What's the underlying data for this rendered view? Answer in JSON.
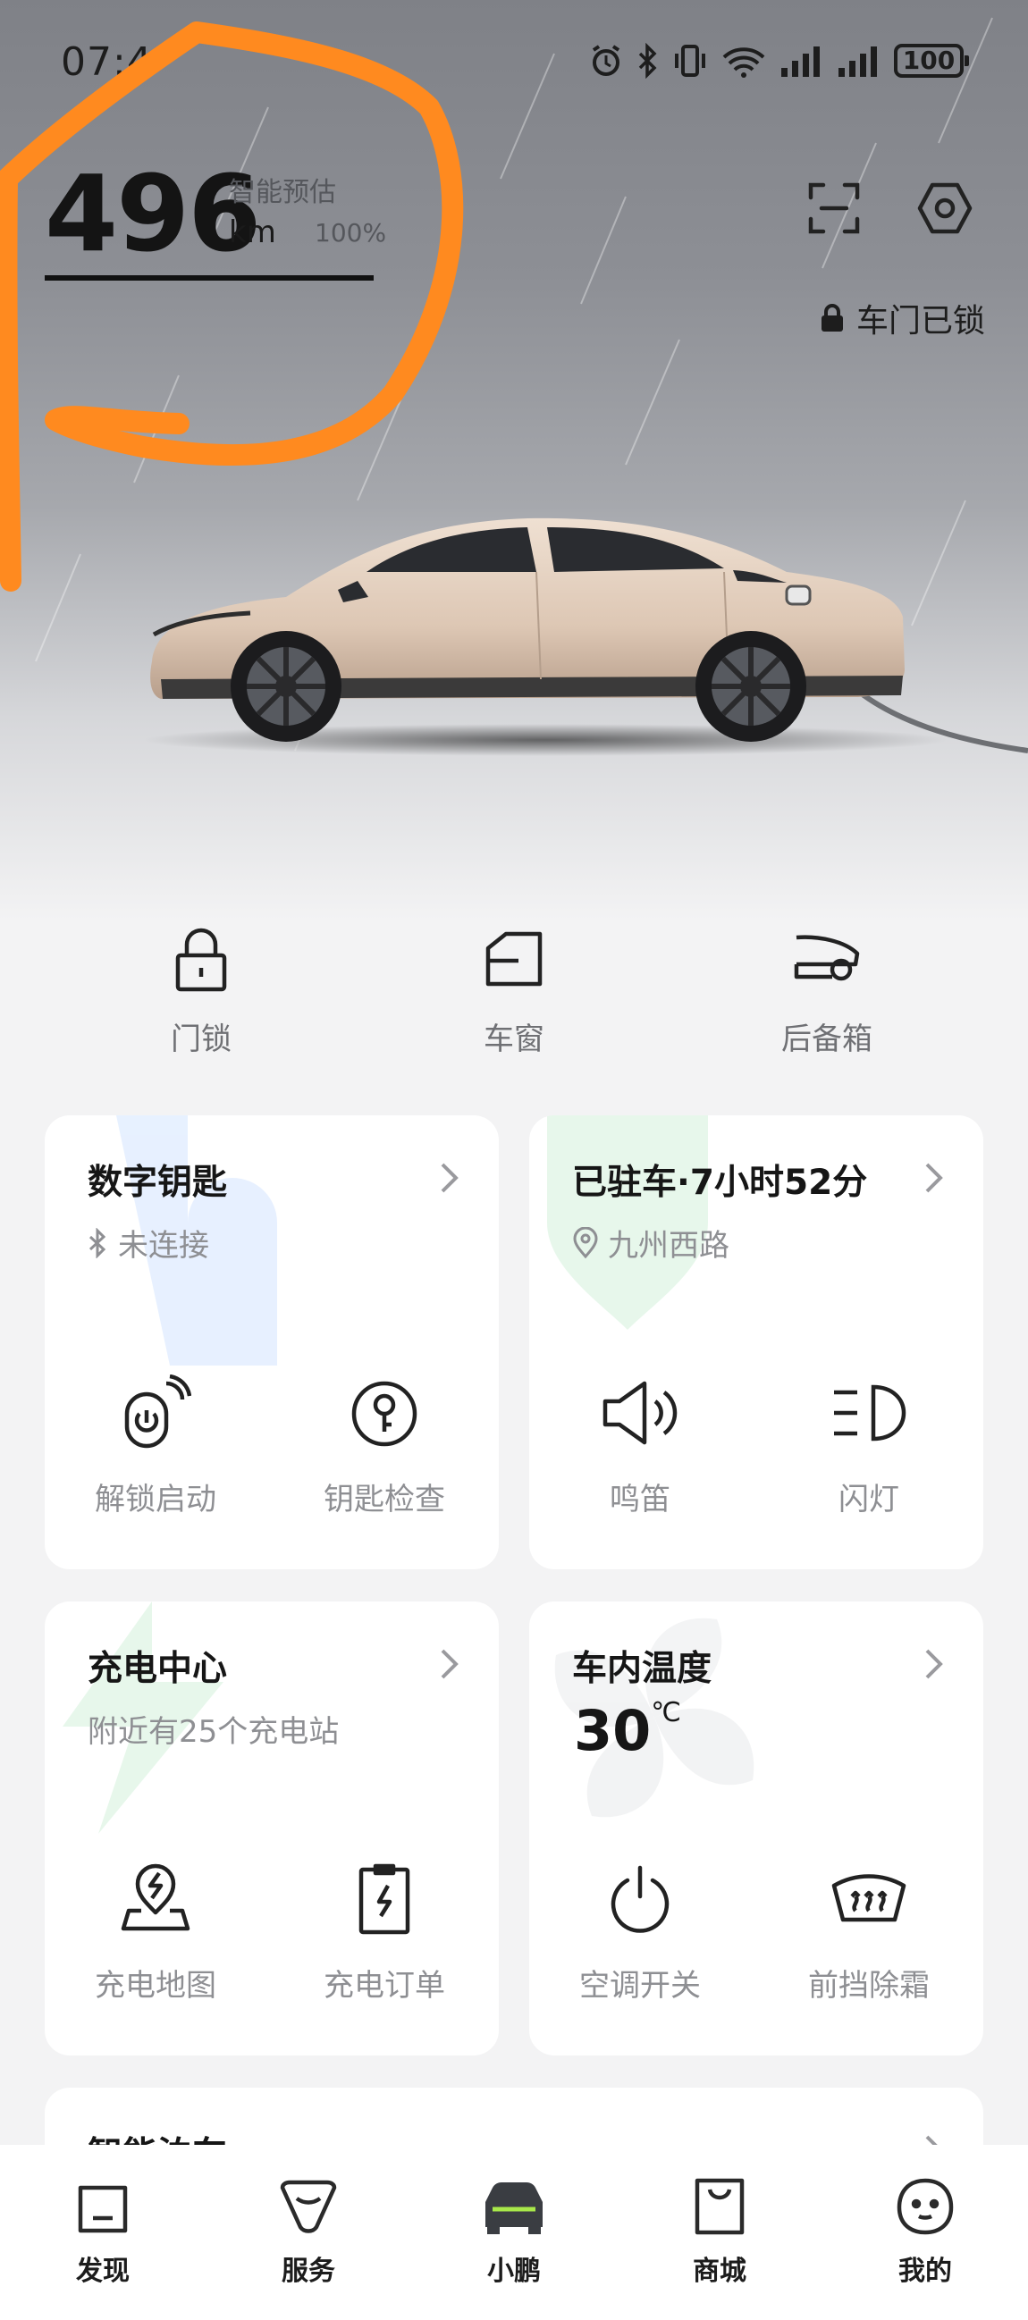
{
  "status_bar": {
    "time": "07:4",
    "battery": "100"
  },
  "range": {
    "value": "496",
    "unit": "km",
    "label": "智能预估",
    "percent": "100%"
  },
  "lock_status": "车门已锁",
  "quick_controls": [
    {
      "label": "门锁",
      "icon": "lock-icon"
    },
    {
      "label": "车窗",
      "icon": "window-icon"
    },
    {
      "label": "后备箱",
      "icon": "trunk-icon"
    }
  ],
  "cards": {
    "digital_key": {
      "title": "数字钥匙",
      "sub": "未连接",
      "actions": [
        {
          "label": "解锁启动",
          "icon": "unlock-start-icon"
        },
        {
          "label": "钥匙检查",
          "icon": "key-check-icon"
        }
      ]
    },
    "parking": {
      "title": "已驻车·7小时52分",
      "sub": "九州西路",
      "actions": [
        {
          "label": "鸣笛",
          "icon": "horn-icon"
        },
        {
          "label": "闪灯",
          "icon": "flash-light-icon"
        }
      ]
    },
    "charging": {
      "title": "充电中心",
      "sub": "附近有25个充电站",
      "actions": [
        {
          "label": "充电地图",
          "icon": "charge-map-icon"
        },
        {
          "label": "充电订单",
          "icon": "charge-order-icon"
        }
      ]
    },
    "climate": {
      "title": "车内温度",
      "temp": "30",
      "temp_unit": "℃",
      "actions": [
        {
          "label": "空调开关",
          "icon": "power-icon"
        },
        {
          "label": "前挡除霜",
          "icon": "defrost-icon"
        }
      ]
    },
    "smart_parking": {
      "title": "智能泊车"
    }
  },
  "bottom_nav": [
    {
      "label": "发现",
      "icon": "discover-icon"
    },
    {
      "label": "服务",
      "icon": "service-icon"
    },
    {
      "label": "小鹏",
      "icon": "car-icon",
      "active": true
    },
    {
      "label": "商城",
      "icon": "shop-icon"
    },
    {
      "label": "我的",
      "icon": "profile-icon"
    }
  ],
  "colors": {
    "accent": "#a8e84a",
    "annotation": "#ff8a1f",
    "car_body": "#e2cdbb"
  }
}
